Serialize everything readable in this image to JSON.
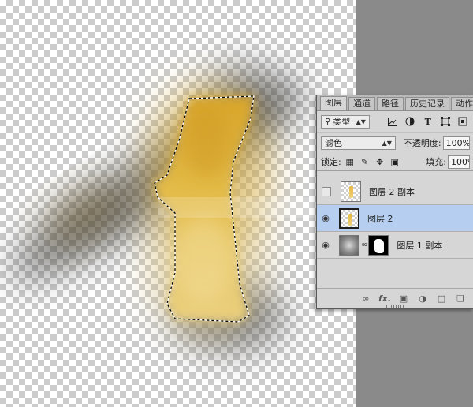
{
  "layers_panel": {
    "tabs": [
      "图层",
      "通道",
      "路径",
      "历史记录",
      "动作"
    ],
    "filter": {
      "label": "类型"
    },
    "blend_mode": "滤色",
    "opacity": {
      "label": "不透明度:",
      "value": "100%"
    },
    "lock_label": "锁定:",
    "fill": {
      "label": "填充:",
      "value": "100%"
    },
    "layers": [
      {
        "name": "图层 2 副本",
        "visible": false,
        "selected": false
      },
      {
        "name": "图层 2",
        "visible": true,
        "selected": true
      },
      {
        "name": "图层 1 副本",
        "visible": true,
        "selected": false
      }
    ],
    "footer_fx": "fx."
  },
  "colors": {
    "selection": "#b6cff0",
    "gold": "#e2b63a",
    "pasteboard": "#8a8a8a"
  },
  "icons": {
    "filter": "search-icon",
    "visible": "eye-icon",
    "link": "chain-link-icon"
  }
}
